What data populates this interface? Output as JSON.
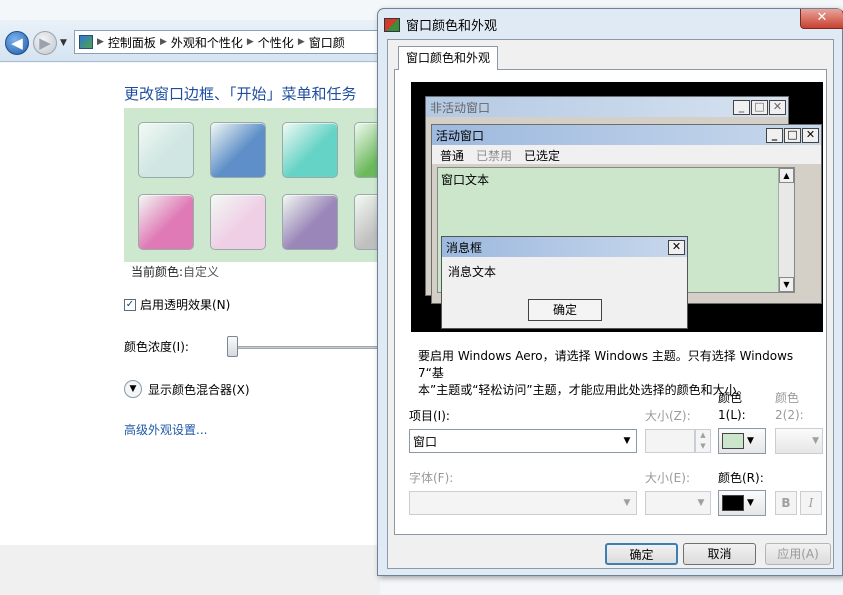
{
  "background": {
    "breadcrumb": [
      "控制面板",
      "外观和个性化",
      "个性化",
      "窗口颜"
    ],
    "title": "更改窗口边框、「开始」菜单和任务",
    "swatch_colors": [
      "#cfe6e2",
      "#5f8fc8",
      "#65d3c6",
      "#6cb95c",
      "#e07ab6",
      "#efcfe6",
      "#9a86b8",
      "#bfbfbf"
    ],
    "current_color_label": "当前颜色:",
    "current_color_value": "自定义",
    "transparency_label": "启用透明效果(N)",
    "transparency_checked": true,
    "intensity_label": "颜色浓度(I):",
    "intensity_level": 0.0,
    "mixer_label": "显示颜色混合器(X)",
    "advanced_link": "高级外观设置..."
  },
  "dialog": {
    "title": "窗口颜色和外观",
    "close_glyph": "✕",
    "tab_label": "窗口颜色和外观",
    "preview": {
      "inactive_title": "非活动窗口",
      "active_title": "活动窗口",
      "menu_normal": "普通",
      "menu_disabled": "已禁用",
      "menu_selected": "已选定",
      "window_text": "窗口文本",
      "msgbox_title": "消息框",
      "msgbox_text": "消息文本",
      "msgbox_ok": "确定",
      "min_glyph": "_",
      "max_glyph": "□",
      "close_glyph": "✕"
    },
    "hint_line1": "要启用 Windows Aero，请选择 Windows 主题。只有选择 Windows 7“基",
    "hint_line2": "本”主题或“轻松访问”主题，才能应用此处选择的颜色和大小。",
    "item_label": "项目(I):",
    "item_value": "窗口",
    "size_label": "大小(Z):",
    "color1_label_a": "颜色",
    "color1_label_b": "1(L):",
    "color1_value": "#cce6cc",
    "color2_label_a": "颜色",
    "color2_label_b": "2(2):",
    "font_label": "字体(F):",
    "font_size_label": "大小(E):",
    "font_color_label": "颜色(R):",
    "font_color_value": "#000000",
    "bold_label": "B",
    "italic_label": "I",
    "ok_label": "确定",
    "cancel_label": "取消",
    "apply_label": "应用(A)"
  }
}
